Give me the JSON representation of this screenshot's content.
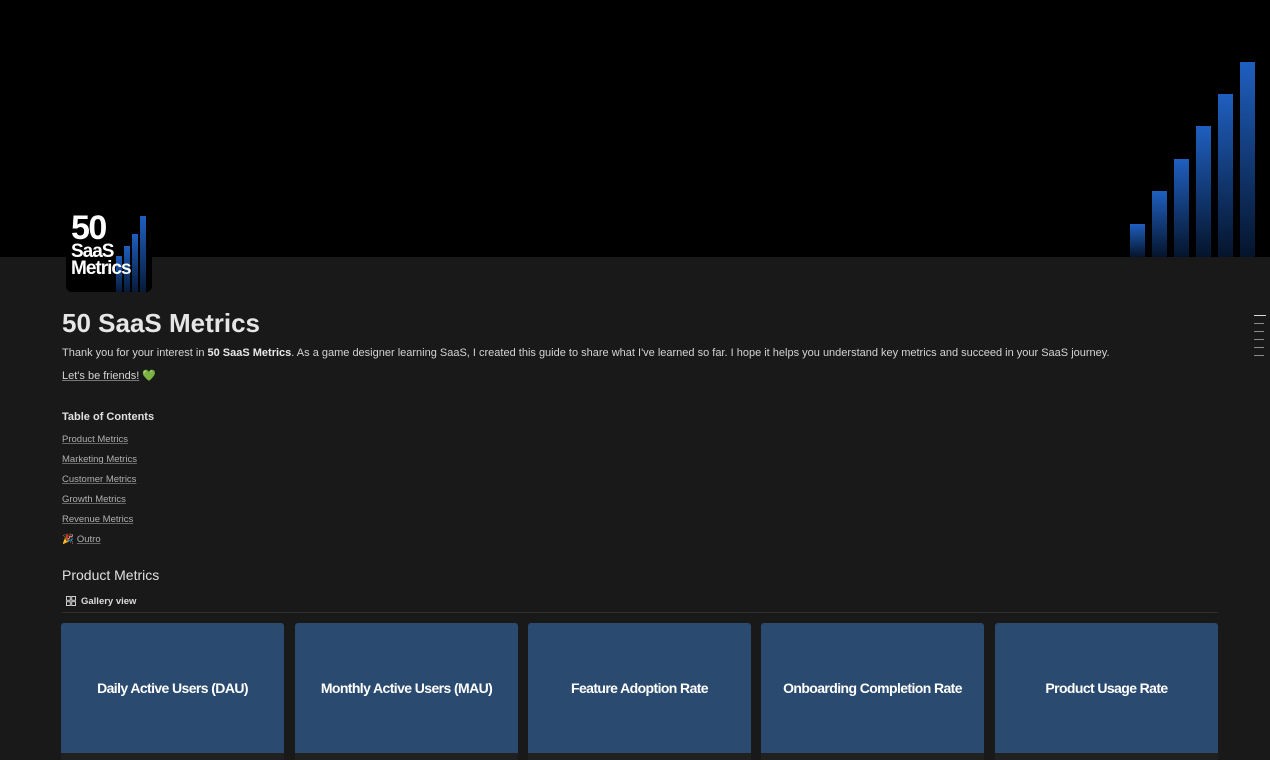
{
  "page": {
    "title": "50 SaaS Metrics",
    "logo": {
      "big": "50",
      "line2": "SaaS",
      "line3": "Metrics"
    },
    "intro": {
      "before": "Thank you for your interest in ",
      "bold": "50 SaaS Metrics",
      "after": ". As a game designer learning SaaS, I created this guide to share what I've learned so far. I hope it helps you understand key metrics and succeed in your SaaS journey."
    },
    "friends": {
      "link": "Let's be friends!",
      "emoji": "💚"
    }
  },
  "toc": {
    "title": "Table of Contents",
    "items": [
      {
        "label": "Product Metrics"
      },
      {
        "label": "Marketing Metrics"
      },
      {
        "label": "Customer Metrics"
      },
      {
        "label": "Growth Metrics"
      },
      {
        "label": "Revenue Metrics"
      },
      {
        "label": "Outro",
        "emoji": "🎉"
      }
    ]
  },
  "section": {
    "title": "Product Metrics",
    "view_label": "Gallery view",
    "view_icon": "gallery-grid-icon",
    "cards": [
      {
        "title": "Daily Active Users (DAU)"
      },
      {
        "title": "Monthly Active Users (MAU)"
      },
      {
        "title": "Feature Adoption Rate"
      },
      {
        "title": "Onboarding Completion Rate"
      },
      {
        "title": "Product Usage Rate"
      }
    ]
  },
  "colors": {
    "background": "#191919",
    "cover": "#000000",
    "card_cover": "#2a4a70",
    "bar_accent": "#1f5fbf"
  }
}
